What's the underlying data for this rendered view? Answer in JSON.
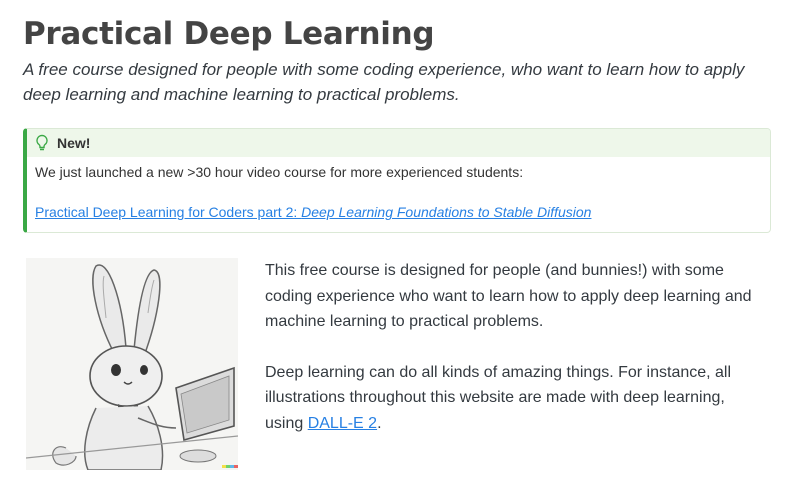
{
  "page": {
    "title": "Practical Deep Learning",
    "subtitle": "A free course designed for people with some coding experience, who want to learn how to apply deep learning and machine learning to practical problems."
  },
  "callout": {
    "title": "New!",
    "text": "We just launched a new >30 hour video course for more experienced students:",
    "link_prefix": "Practical Deep Learning for Coders part 2: ",
    "link_emphasis": "Deep Learning Foundations to Stable Diffusion",
    "icon": "lightbulb-icon",
    "accent_color": "#3aa845"
  },
  "content": {
    "image_icon": "bunny-illustration",
    "paragraph1": "This free course is designed for people (and bunnies!) with some coding experience who want to learn how to apply deep learning and machine learning to practical problems.",
    "paragraph2_before": "Deep learning can do all kinds of amazing things. For instance, all illustrations throughout this website are made with deep learning, using ",
    "paragraph2_link": "DALL-E 2",
    "paragraph2_after": "."
  },
  "colors": {
    "link": "#2780e3",
    "title": "#444444",
    "callout_header_bg": "#eef7ea"
  }
}
